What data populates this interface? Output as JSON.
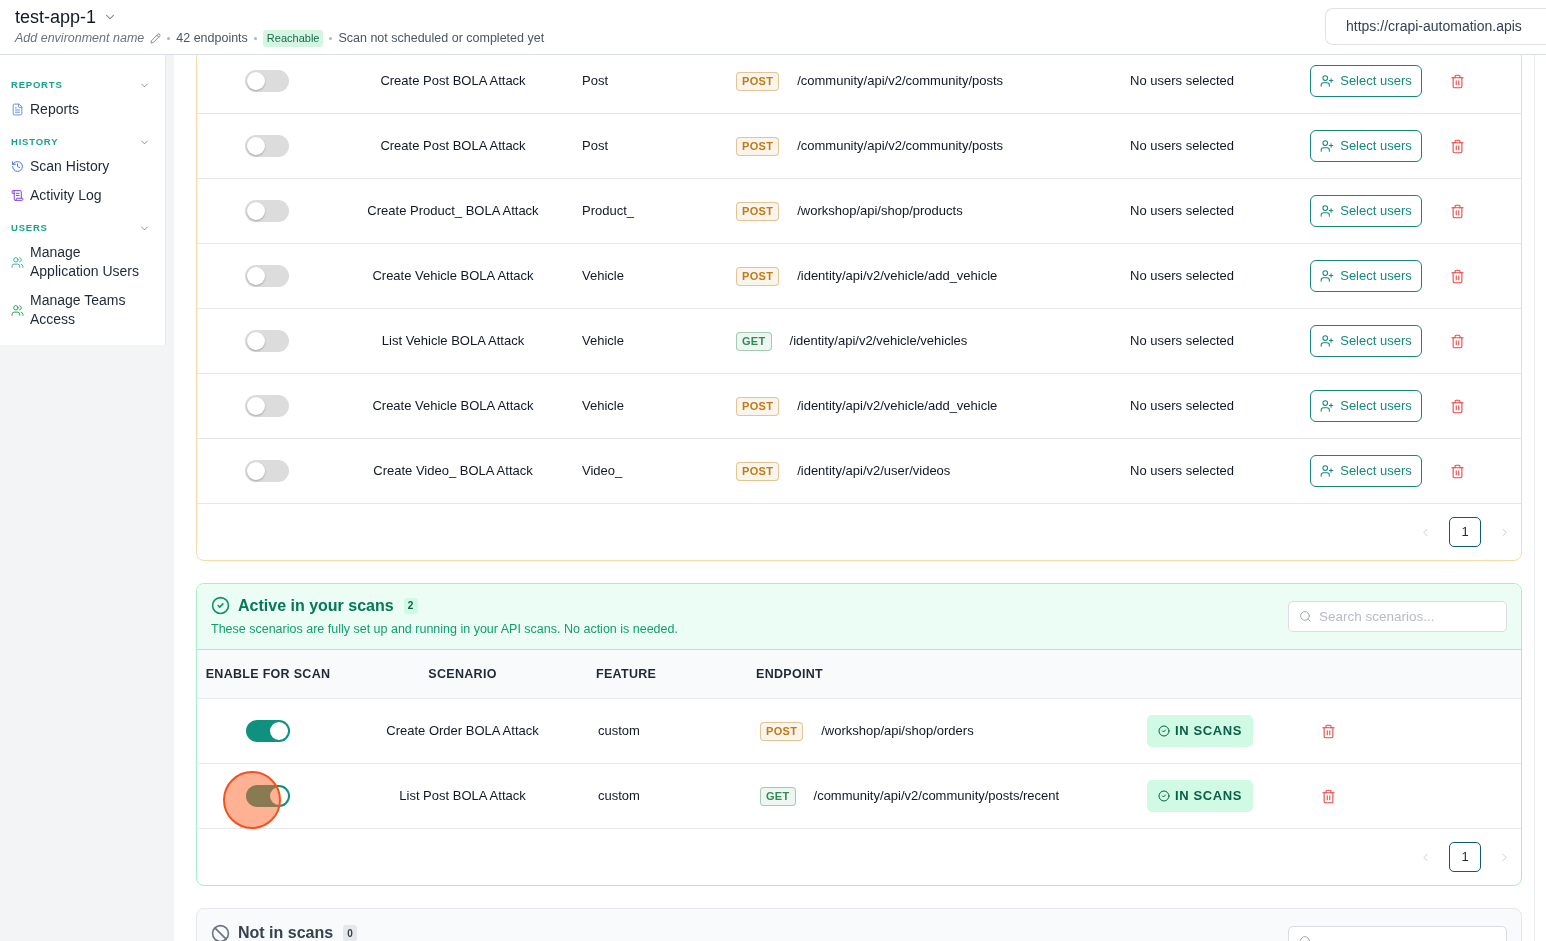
{
  "header": {
    "title": "test-app-1",
    "environment_placeholder": "Add environment name",
    "endpoint_count": "42 endpoints",
    "status_badge": "Reachable",
    "scan_status": "Scan not scheduled or completed yet",
    "url": "https://crapi-automation.apis"
  },
  "sidebar": {
    "sections": [
      {
        "title": "REPORTS",
        "expanded": true,
        "items": [
          {
            "label": "Reports",
            "kind": "report"
          }
        ]
      },
      {
        "title": "HISTORY",
        "expanded": true,
        "items": [
          {
            "label": "Scan History",
            "kind": "history"
          },
          {
            "label": "Activity Log",
            "kind": "log"
          }
        ]
      },
      {
        "title": "USERS",
        "expanded": true,
        "items": [
          {
            "label": "Manage Application Users",
            "kind": "users"
          },
          {
            "label": "Manage Teams Access",
            "kind": "teams"
          }
        ]
      }
    ]
  },
  "pending_table": {
    "rows": [
      {
        "enabled": false,
        "scenario": "Create Post BOLA Attack",
        "feature": "Post",
        "method": {
          "label": "POST",
          "color": "#c27a12"
        },
        "endpoint": "/community/api/v2/community/posts",
        "users": "No users selected",
        "action": "Select users"
      },
      {
        "enabled": false,
        "scenario": "Create Post BOLA Attack",
        "feature": "Post",
        "method": {
          "label": "POST",
          "color": "#c27a12"
        },
        "endpoint": "/community/api/v2/community/posts",
        "users": "No users selected",
        "action": "Select users"
      },
      {
        "enabled": false,
        "scenario": "Create Product_ BOLA Attack",
        "feature": "Product_",
        "method": {
          "label": "POST",
          "color": "#c27a12"
        },
        "endpoint": "/workshop/api/shop/products",
        "users": "No users selected",
        "action": "Select users"
      },
      {
        "enabled": false,
        "scenario": "Create Vehicle BOLA Attack",
        "feature": "Vehicle",
        "method": {
          "label": "POST",
          "color": "#c27a12"
        },
        "endpoint": "/identity/api/v2/vehicle/add_vehicle",
        "users": "No users selected",
        "action": "Select users"
      },
      {
        "enabled": false,
        "scenario": "List Vehicle BOLA Attack",
        "feature": "Vehicle",
        "method": {
          "label": "GET",
          "color": "#2e8b57"
        },
        "endpoint": "/identity/api/v2/vehicle/vehicles",
        "users": "No users selected",
        "action": "Select users"
      },
      {
        "enabled": false,
        "scenario": "Create Vehicle BOLA Attack",
        "feature": "Vehicle",
        "method": {
          "label": "POST",
          "color": "#c27a12"
        },
        "endpoint": "/identity/api/v2/vehicle/add_vehicle",
        "users": "No users selected",
        "action": "Select users"
      },
      {
        "enabled": false,
        "scenario": "Create Video_ BOLA Attack",
        "feature": "Video_",
        "method": {
          "label": "POST",
          "color": "#c27a12"
        },
        "endpoint": "/identity/api/v2/user/videos",
        "users": "No users selected",
        "action": "Select users"
      }
    ],
    "pagination": {
      "previous_disabled": true,
      "next_disabled": true,
      "pages": [
        {
          "label": "1",
          "selected": true
        }
      ]
    }
  },
  "active_section": {
    "title": "Active in your scans",
    "count": "2",
    "description": "These scenarios are fully set up and running in your API scans. No action is needed.",
    "search": {
      "placeholder": "Search scenarios..."
    },
    "columns": [
      "ENABLE FOR SCAN",
      "SCENARIO",
      "FEATURE",
      "ENDPOINT"
    ],
    "rows": [
      {
        "enabled": true,
        "click_highlight": false,
        "scenario": "Create Order BOLA Attack",
        "feature": "custom",
        "method": {
          "label": "POST",
          "color": "#c27a12"
        },
        "endpoint": "/workshop/api/shop/orders",
        "status": "IN SCANS"
      },
      {
        "enabled": true,
        "click_highlight": true,
        "scenario": "List Post BOLA Attack",
        "feature": "custom",
        "method": {
          "label": "GET",
          "color": "#2e8b57"
        },
        "endpoint": "/community/api/v2/community/posts/recent",
        "status": "IN SCANS"
      }
    ],
    "pagination": {
      "previous_disabled": true,
      "next_disabled": true,
      "pages": [
        {
          "label": "1",
          "selected": true
        }
      ]
    }
  },
  "not_in_scans_section": {
    "title": "Not in scans",
    "count": "0",
    "search_field": true
  }
}
